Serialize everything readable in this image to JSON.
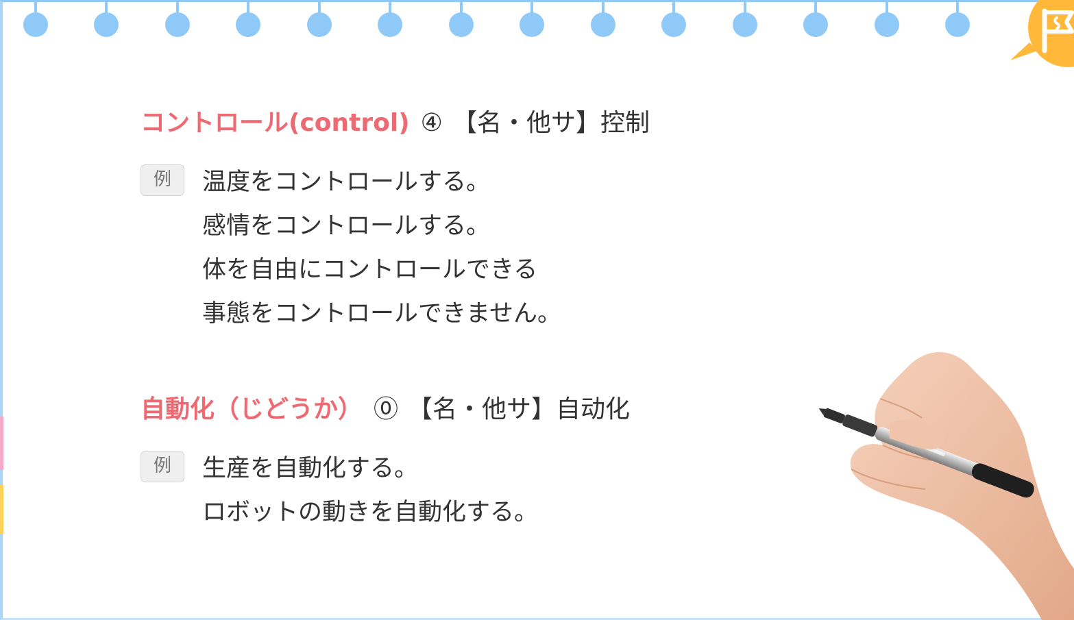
{
  "entries": [
    {
      "word": "コントロール(control)",
      "accent": "④",
      "pos": "【名・他サ】",
      "gloss": "控制",
      "example_badge": "例",
      "examples": [
        "温度をコントロールする。",
        "感情をコントロールする。",
        "体を自由にコントロールできる",
        "事態をコントロールできません。"
      ]
    },
    {
      "word": "自動化（じどうか）",
      "accent": "⓪",
      "pos": "【名・他サ】",
      "gloss": "自动化",
      "example_badge": "例",
      "examples": [
        "生産を自動化する。",
        "ロボットの動きを自動化する。"
      ]
    }
  ],
  "colors": {
    "headword": "#ee6a72",
    "ring": "#8ec9f7",
    "flag_badge": "#ffb83a",
    "tab_pink": "#f6a9c6",
    "tab_yellow": "#ffd35b"
  },
  "icons": {
    "corner": "flag-icon",
    "illustration": "hand-holding-pen"
  }
}
